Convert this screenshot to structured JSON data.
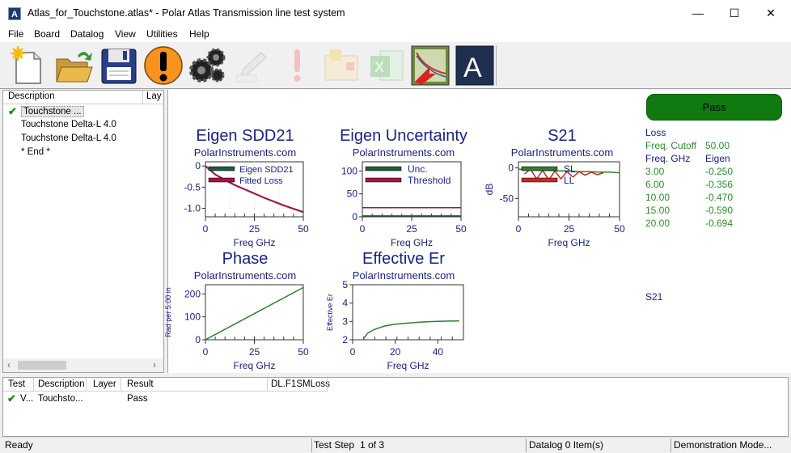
{
  "window": {
    "title": "Atlas_for_Touchstone.atlas* - Polar Atlas Transmission line test system",
    "app_icon": "A",
    "minimize": "—",
    "maximize": "☐",
    "close": "✕"
  },
  "menu": [
    "File",
    "Board",
    "Datalog",
    "View",
    "Utilities",
    "Help"
  ],
  "toolbar": [
    "new-file-icon",
    "open-folder-icon",
    "save-disk-icon",
    "alert-icon",
    "gears-icon",
    "edit-disabled-icon",
    "warning-disabled-icon",
    "report-disabled-icon",
    "excel-disabled-icon",
    "chart-export-icon",
    "atlas-logo-icon"
  ],
  "tree": {
    "headers": [
      "Description",
      "Lay"
    ],
    "items": [
      "Touchstone ...",
      "Touchstone Delta-L 4.0",
      "Touchstone Delta-L 4.0",
      "* End *"
    ]
  },
  "pass_label": "Pass",
  "charts": {
    "sdd21": {
      "title": "Eigen SDD21",
      "subtitle": "PolarInstruments.com",
      "xlabel": "Freq GHz",
      "yticks": [
        "0",
        "-0.5",
        "-1.0"
      ],
      "xticks": [
        "0",
        "25",
        "50"
      ],
      "legend": [
        "Eigen SDD21",
        "Fitted Loss"
      ]
    },
    "uncertainty": {
      "title": "Eigen Uncertainty",
      "subtitle": "PolarInstruments.com",
      "xlabel": "Freq GHz",
      "yticks": [
        "100",
        "50",
        "0"
      ],
      "xticks": [
        "0",
        "25",
        "50"
      ],
      "legend": [
        "Unc.",
        "Threshold"
      ]
    },
    "s21": {
      "title": "S21",
      "subtitle": "PolarInstruments.com",
      "xlabel": "Freq GHz",
      "ylabel": "dB",
      "yticks": [
        "0",
        "-50"
      ],
      "xticks": [
        "0",
        "25",
        "50"
      ],
      "legend": [
        "SL",
        "LL"
      ]
    },
    "phase": {
      "title": "Phase",
      "subtitle": "PolarInstruments.com",
      "xlabel": "Freq GHz",
      "ylabel": "Rad per 5.00 in",
      "yticks": [
        "200",
        "100",
        "0"
      ],
      "xticks": [
        "0",
        "25",
        "50"
      ]
    },
    "er": {
      "title": "Effective Er",
      "subtitle": "PolarInstruments.com",
      "xlabel": "Freq GHz",
      "ylabel": "Effective Er",
      "yticks": [
        "5",
        "4",
        "3",
        "2"
      ],
      "xticks": [
        "0",
        "20",
        "40"
      ]
    }
  },
  "chart_data": [
    {
      "type": "line",
      "title": "Eigen SDD21",
      "xlabel": "Freq GHz",
      "xlim": [
        0,
        50
      ],
      "ylim": [
        -1.2,
        0.1
      ],
      "series": [
        {
          "name": "Eigen SDD21",
          "x": [
            0,
            5,
            10,
            15,
            20,
            25,
            30,
            35,
            40,
            45,
            50
          ],
          "y": [
            0,
            -0.2,
            -0.33,
            -0.45,
            -0.55,
            -0.65,
            -0.75,
            -0.84,
            -0.93,
            -1.01,
            -1.09
          ]
        },
        {
          "name": "Fitted Loss",
          "x": [
            0,
            5,
            10,
            15,
            20,
            25,
            30,
            35,
            40,
            45,
            50
          ],
          "y": [
            0,
            -0.2,
            -0.33,
            -0.45,
            -0.55,
            -0.65,
            -0.75,
            -0.84,
            -0.93,
            -1.01,
            -1.09
          ]
        }
      ]
    },
    {
      "type": "line",
      "title": "Eigen Uncertainty",
      "xlabel": "Freq GHz",
      "xlim": [
        0,
        50
      ],
      "ylim": [
        0,
        120
      ],
      "series": [
        {
          "name": "Unc.",
          "x": [
            0,
            50
          ],
          "y": [
            2,
            2
          ]
        },
        {
          "name": "Threshold",
          "x": [
            0,
            50
          ],
          "y": [
            20,
            20
          ]
        }
      ]
    },
    {
      "type": "line",
      "title": "S21",
      "xlabel": "Freq GHz",
      "ylabel": "dB",
      "xlim": [
        0,
        50
      ],
      "ylim": [
        -80,
        10
      ],
      "series": [
        {
          "name": "SL",
          "x": [
            0,
            5,
            10,
            15,
            20,
            25,
            30,
            35,
            40,
            45,
            50
          ],
          "y": [
            -2,
            -3,
            -4,
            -4,
            -5,
            -5,
            -6,
            -6,
            -7,
            -7,
            -8
          ]
        },
        {
          "name": "LL",
          "x": [
            3,
            6,
            9,
            12,
            15,
            18,
            21,
            24,
            27,
            30,
            33,
            36,
            39,
            42
          ],
          "y": [
            -10,
            -2,
            -18,
            -4,
            -20,
            -5,
            -18,
            -6,
            -15,
            -6,
            -12,
            -7,
            -11,
            -8
          ]
        }
      ]
    },
    {
      "type": "line",
      "title": "Phase",
      "xlabel": "Freq GHz",
      "ylabel": "Rad per 5.00 in",
      "xlim": [
        0,
        50
      ],
      "ylim": [
        0,
        240
      ],
      "series": [
        {
          "name": "Phase",
          "x": [
            0,
            50
          ],
          "y": [
            0,
            228
          ]
        }
      ]
    },
    {
      "type": "line",
      "title": "Effective Er",
      "xlabel": "Freq GHz",
      "ylabel": "Effective Er",
      "xlim": [
        0,
        52
      ],
      "ylim": [
        2,
        5
      ],
      "series": [
        {
          "name": "Effective Er",
          "x": [
            5,
            7,
            10,
            15,
            20,
            25,
            30,
            35,
            40,
            45,
            50
          ],
          "y": [
            2.05,
            2.35,
            2.55,
            2.75,
            2.85,
            2.9,
            2.95,
            2.98,
            3.0,
            3.02,
            3.03
          ]
        }
      ]
    }
  ],
  "results": {
    "loss_label": "Loss",
    "freq_cutoff_label": "Freq. Cutoff",
    "freq_cutoff_value": "50.00",
    "col1": "Freq. GHz",
    "col2": "Eigen",
    "rows": [
      {
        "freq": "3.00",
        "eigen": "-0.250"
      },
      {
        "freq": "6.00",
        "eigen": "-0.356"
      },
      {
        "freq": "10.00",
        "eigen": "-0.470"
      },
      {
        "freq": "15.00",
        "eigen": "-0.590"
      },
      {
        "freq": "20.00",
        "eigen": "-0.694"
      }
    ],
    "s21_label": "S21"
  },
  "bottom": {
    "headers": [
      "Test",
      "Description",
      "Layer",
      "Result",
      "DL.F1SMLoss"
    ],
    "row": {
      "test": "V...",
      "description": "Touchsto...",
      "layer": "",
      "result": "Pass"
    }
  },
  "status": {
    "ready": "Ready",
    "test_step": "Test Step",
    "step_of": "1  of   3",
    "datalog": "Datalog 0 Item(s)",
    "mode": "Demonstration Mode..."
  }
}
